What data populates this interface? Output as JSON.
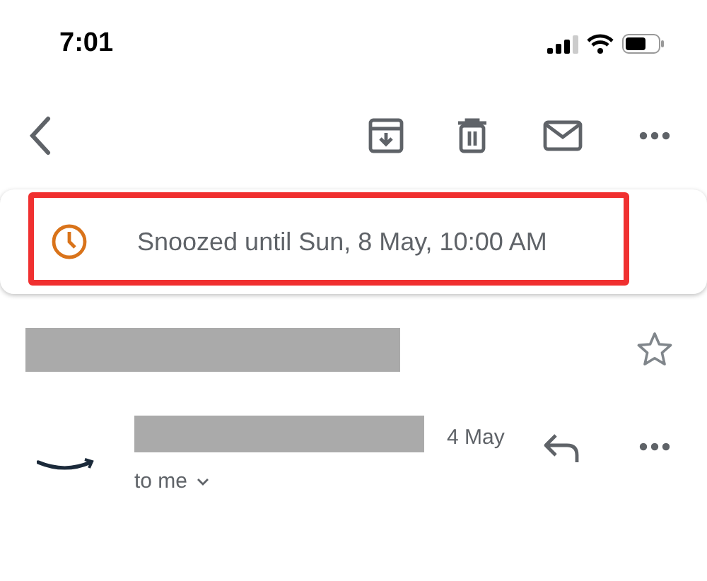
{
  "status_bar": {
    "time": "7:01"
  },
  "snooze_banner": {
    "text": "Snoozed until Sun, 8 May, 10:00 AM",
    "highlighted": true
  },
  "subject": {
    "redacted": true,
    "starred": false
  },
  "message": {
    "sender_redacted": true,
    "date": "4 May",
    "recipient": "to me"
  }
}
